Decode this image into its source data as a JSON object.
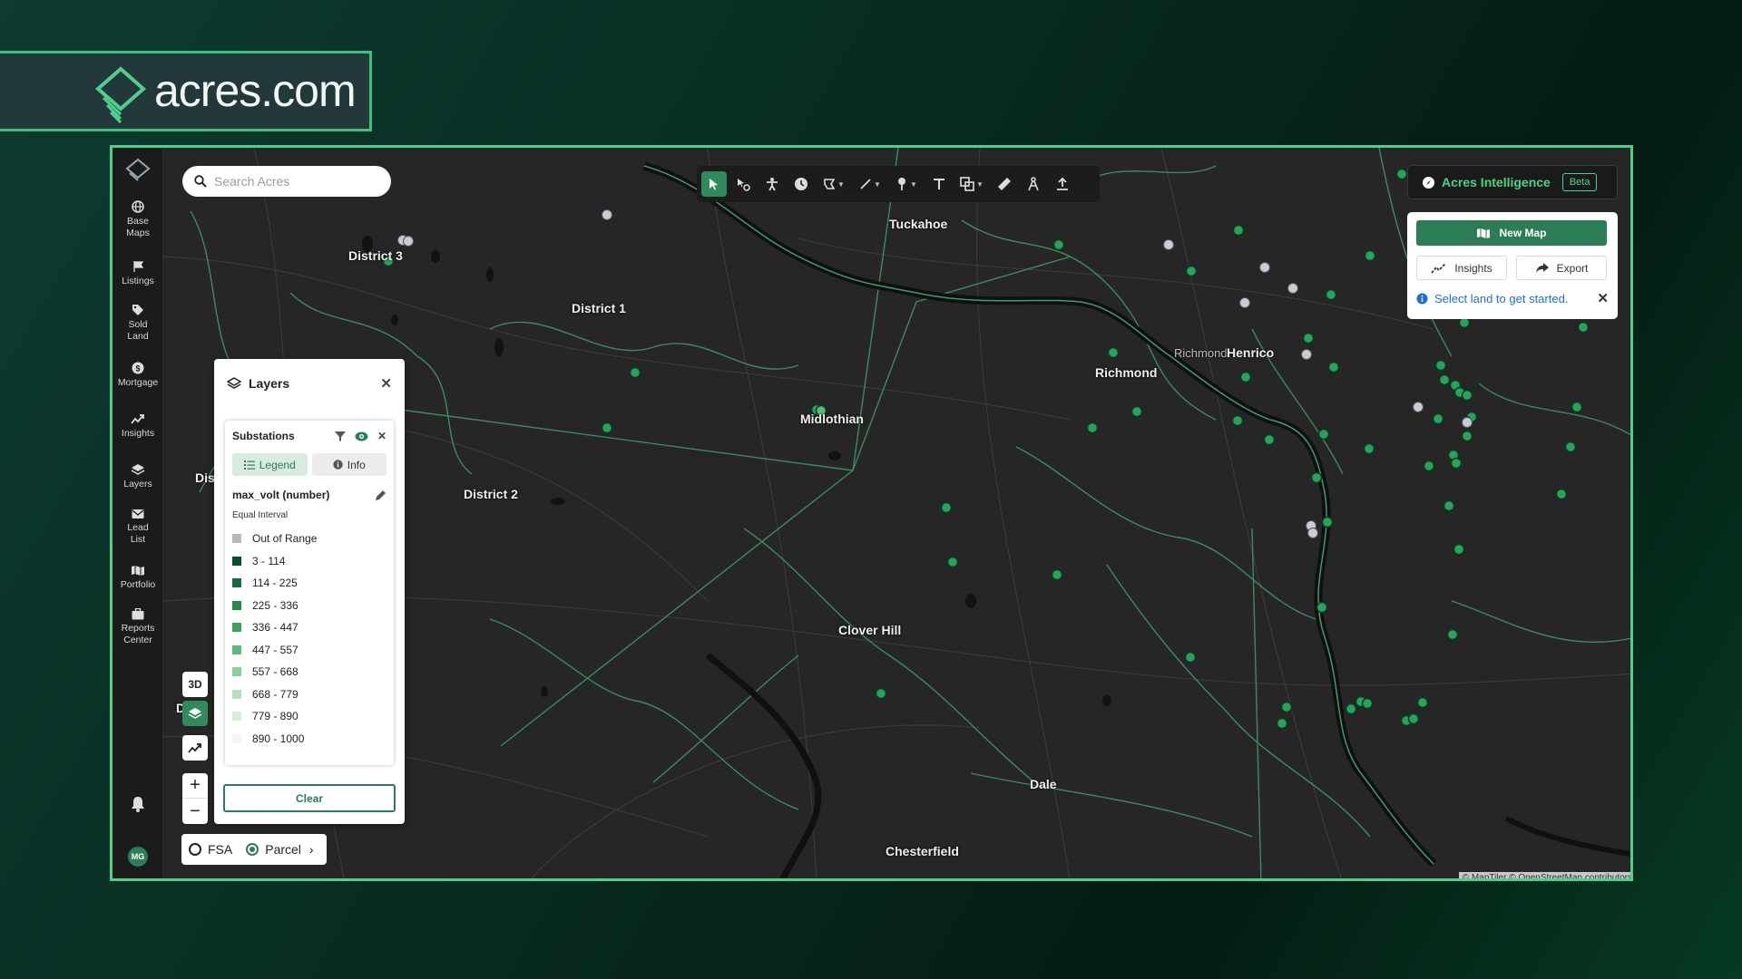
{
  "brand": {
    "name": "acres.com"
  },
  "search": {
    "placeholder": "Search Acres"
  },
  "sidebar": {
    "items": [
      {
        "label_1": "Base",
        "label_2": "Maps",
        "icon": "globe-icon"
      },
      {
        "label_1": "Listings",
        "icon": "flag-icon"
      },
      {
        "label_1": "Sold",
        "label_2": "Land",
        "icon": "tag-icon"
      },
      {
        "label_1": "Mortgage",
        "icon": "dollar-icon"
      },
      {
        "label_1": "Insights",
        "icon": "trend-icon"
      },
      {
        "label_1": "Layers",
        "icon": "layers-icon"
      },
      {
        "label_1": "Lead",
        "label_2": "List",
        "icon": "mail-icon"
      },
      {
        "label_1": "Portfolio",
        "icon": "map-icon"
      },
      {
        "label_1": "Reports",
        "label_2": "Center",
        "icon": "briefcase-icon"
      }
    ],
    "avatar_initials": "MG"
  },
  "ai": {
    "title": "Acres Intelligence",
    "badge": "Beta",
    "new_map_label": "New Map",
    "insights_label": "Insights",
    "export_label": "Export",
    "hint": "Select land to get started."
  },
  "layers_panel": {
    "title": "Layers",
    "layer_name": "Substations",
    "tab_legend": "Legend",
    "tab_info": "Info",
    "field": "max_volt (number)",
    "method": "Equal Interval",
    "legend": [
      {
        "label": "Out of Range",
        "color": "#b8b8b8"
      },
      {
        "label": "3 - 114",
        "color": "#0e4d2b"
      },
      {
        "label": "114 - 225",
        "color": "#166b3a"
      },
      {
        "label": "225 - 336",
        "color": "#228a4a"
      },
      {
        "label": "336 - 447",
        "color": "#3aa35d"
      },
      {
        "label": "447 - 557",
        "color": "#5dba78"
      },
      {
        "label": "557 - 668",
        "color": "#8bcf9a"
      },
      {
        "label": "668 - 779",
        "color": "#b5e0bf"
      },
      {
        "label": "779 - 890",
        "color": "#d6eedb"
      },
      {
        "label": "890 - 1000",
        "color": "#eef8f0"
      }
    ],
    "clear_label": "Clear"
  },
  "map_controls": {
    "three_d": "3D",
    "fsa": "FSA",
    "parcel": "Parcel"
  },
  "map_labels": {
    "district_3": "District 3",
    "district_1": "District 1",
    "district_2": "District 2",
    "dist_partial": "Dis",
    "d_partial": "D   ic",
    "tuckahoe": "Tuckahoe",
    "midlothian": "Midlothian",
    "clover_hill": "Clover Hill",
    "richmond": "Richmond",
    "richmond_small": "Richmond",
    "henrico": "Henrico",
    "dale": "Dale",
    "chesterfield": "Chesterfield"
  },
  "attribution": "© MapTiler © OpenStreetMap contributors",
  "colors": {
    "accent": "#2c7c56",
    "brand_green": "#48d488",
    "frame": "#4fcf8a"
  }
}
